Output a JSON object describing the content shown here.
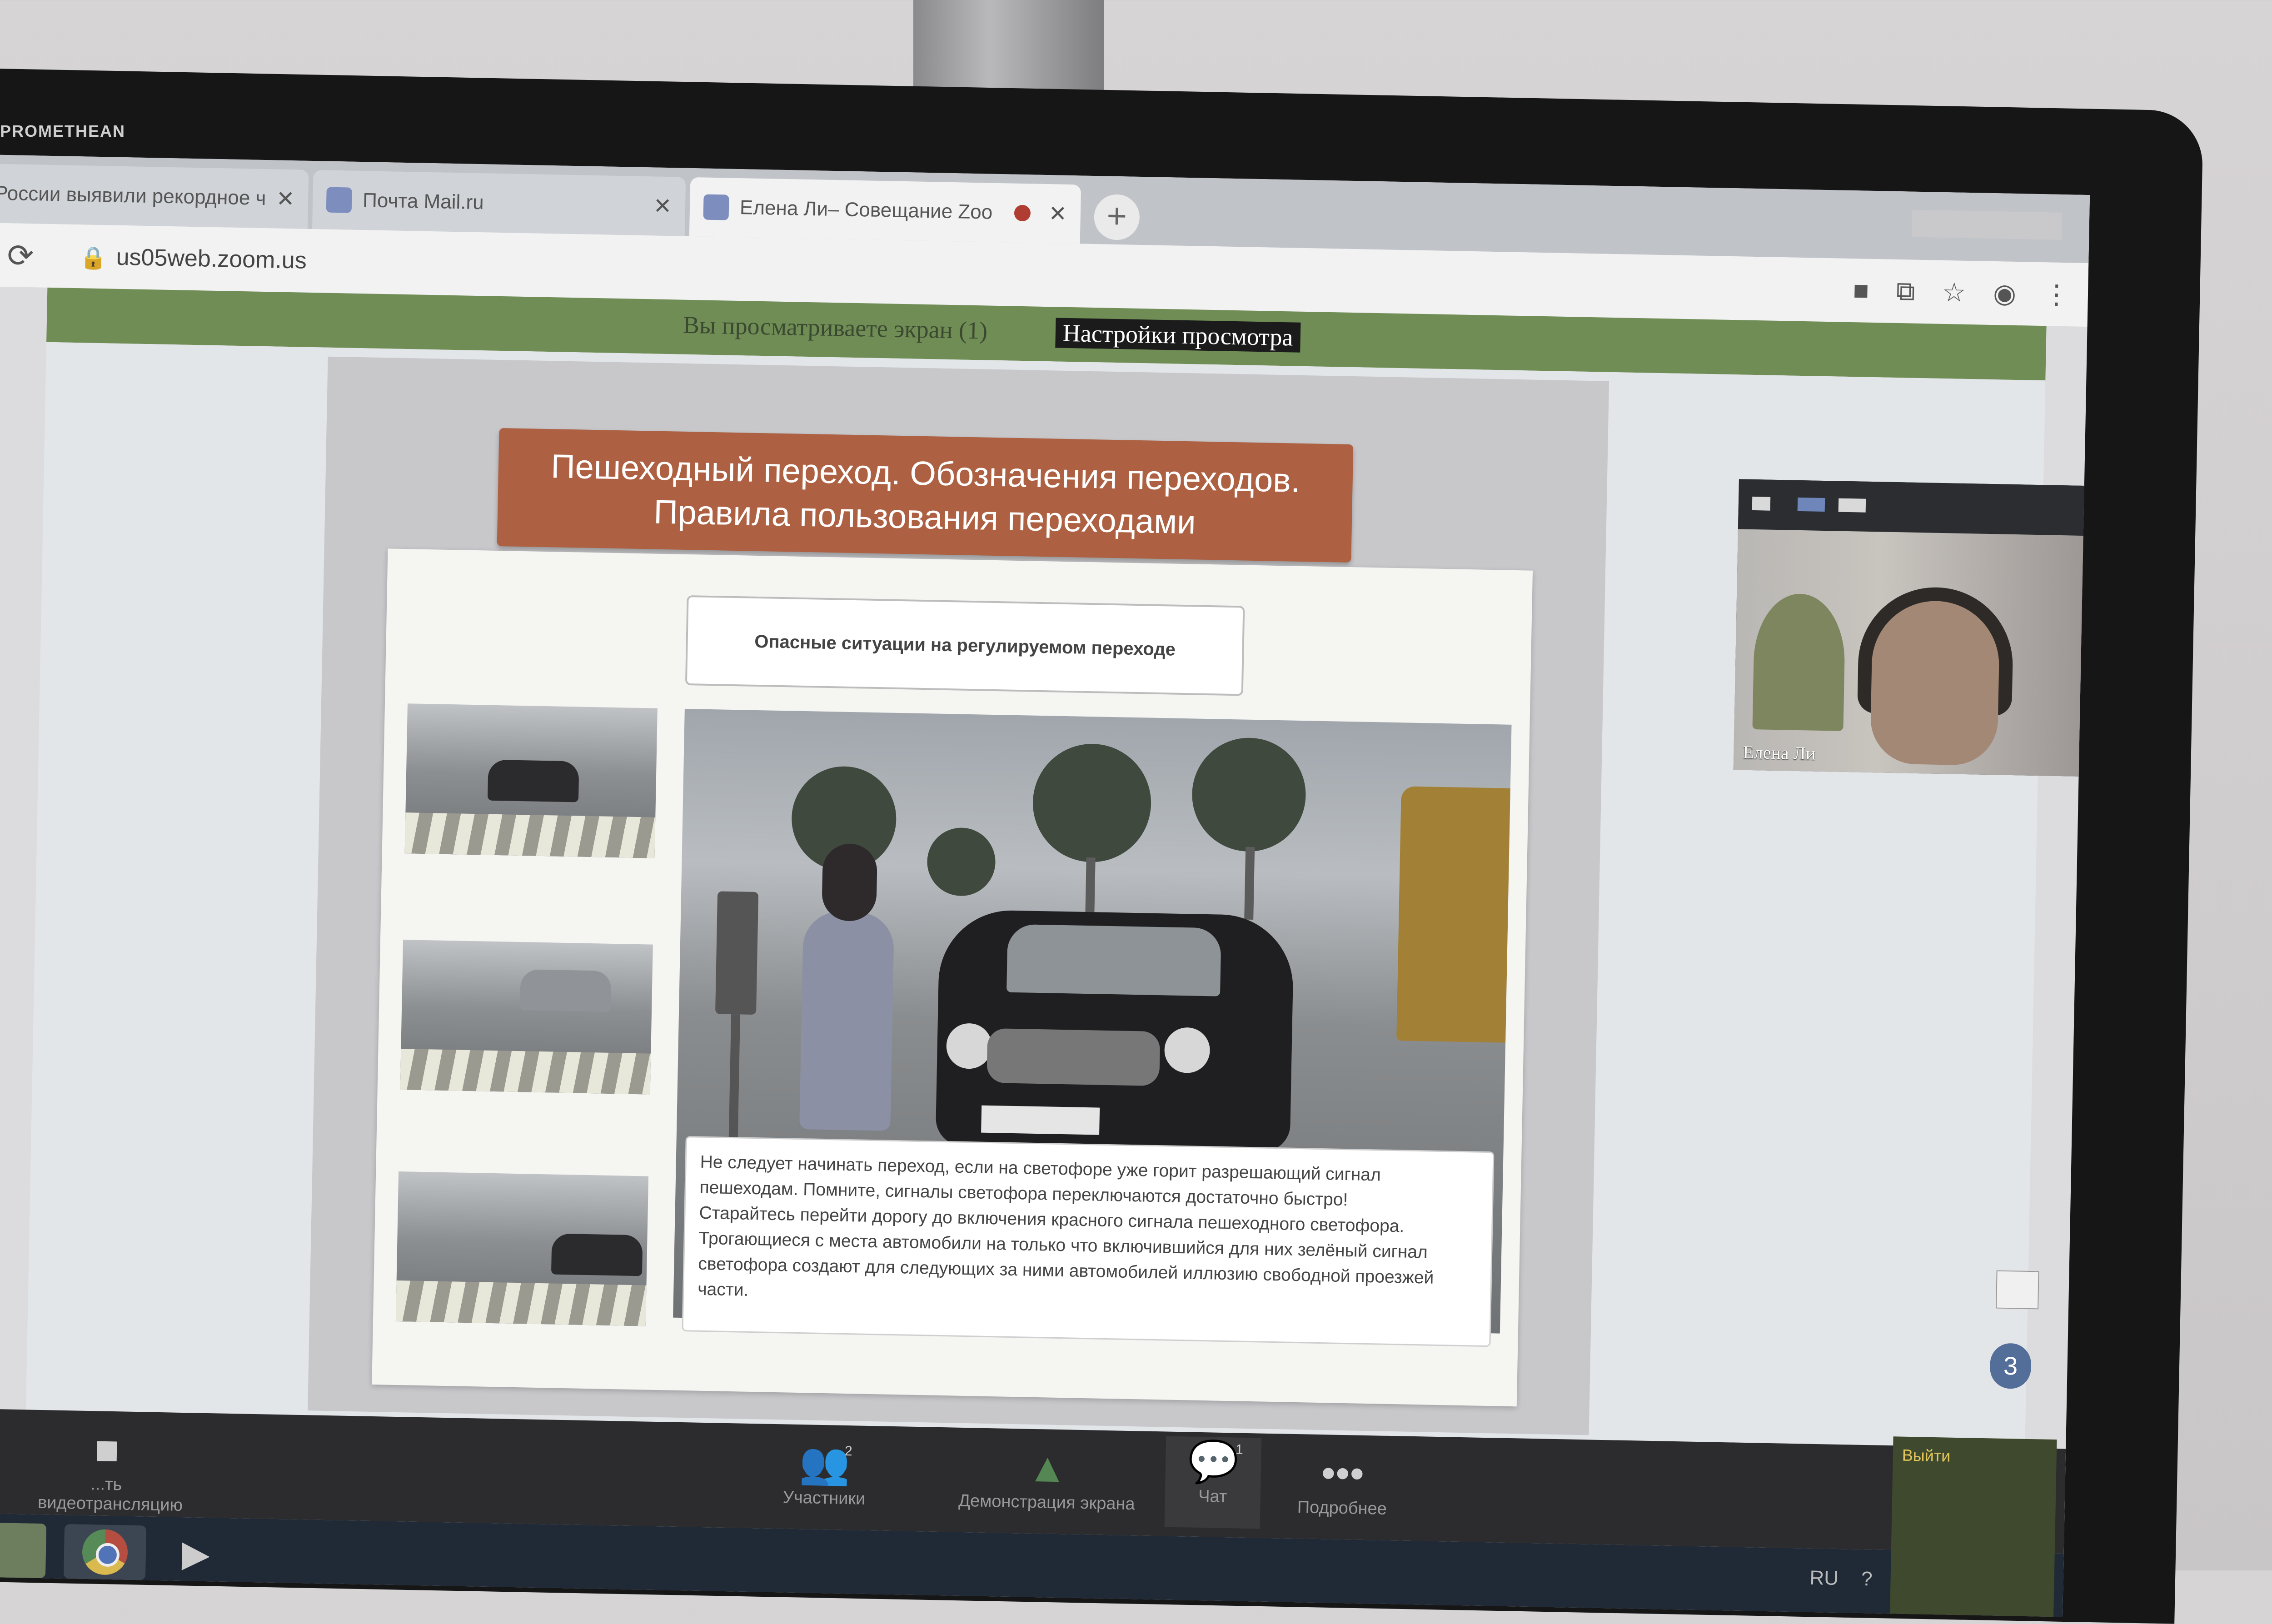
{
  "monitor": {
    "brand": "PROMETHEAN"
  },
  "browser": {
    "tabs": [
      {
        "title": "России выявили рекордное ч",
        "close": "✕"
      },
      {
        "title": "Почта Mail.ru",
        "close": "✕"
      },
      {
        "title": "Елена Ли– Совещание Zoo",
        "close": "✕"
      }
    ],
    "new_tab": "+",
    "reload_icon": "⟳",
    "lock_icon": "🔒",
    "url": "us05web.zoom.us",
    "toolbar_icons": [
      "■",
      "⧉",
      "☆",
      "◉",
      "⋮"
    ]
  },
  "zoom": {
    "share_notice": "Вы просматриваете экран (1)",
    "view_settings": "Настройки просмотра"
  },
  "slide": {
    "title": "Пешеходный переход. Обозначения переходов. Правила пользования переходами",
    "subtitle": "Опасные ситуации на регулируемом переходе",
    "caption_lines": [
      "Не следует начинать переход, если на светофоре уже горит разрешающий сигнал пешеходам. Помните, сигналы светофора переключаются достаточно быстро!",
      "Старайтесь перейти дорогу до включения красного сигнала пешеходного светофора.",
      "Трогающиеся с места автомобили на только что включившийся для них зелёный сигнал светофора создают для следующих за ними автомобилей иллюзию свободной проезжей части."
    ]
  },
  "participant": {
    "name": "Елена Ли"
  },
  "side": {
    "page_number": "3"
  },
  "zoom_toolbar": [
    {
      "label": "...ть видеотрансляцию",
      "icon": "camera-icon"
    },
    {
      "label": "Участники",
      "icon": "participants-icon",
      "count": "2"
    },
    {
      "label": "Демонстрация экрана",
      "icon": "share-screen-icon"
    },
    {
      "label": "Чат",
      "icon": "chat-icon",
      "count": "1"
    },
    {
      "label": "Подробнее",
      "icon": "more-icon"
    }
  ],
  "taskbar": {
    "language": "RU",
    "help": "?",
    "notification": {
      "title": "Выйти"
    }
  },
  "colors": {
    "title_banner": "#b85f3a",
    "share_bar": "#6c8f4d",
    "chat_active": "#e07a3a"
  }
}
